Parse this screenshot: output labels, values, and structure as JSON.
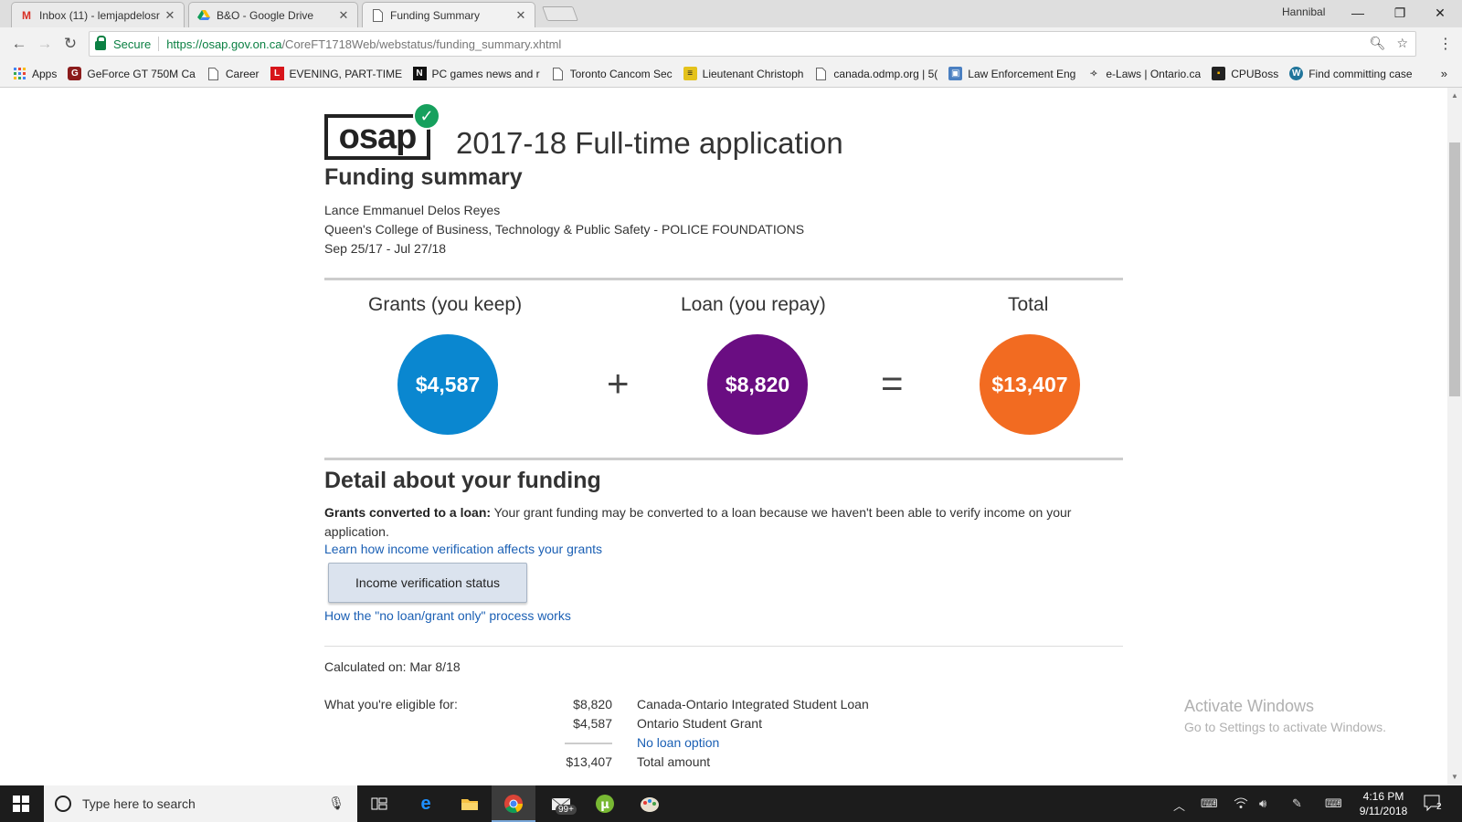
{
  "browser": {
    "tabs": [
      {
        "title": "Inbox (11) - lemjapdelosr",
        "icon": "gmail-icon"
      },
      {
        "title": "B&O - Google Drive",
        "icon": "google-drive-icon"
      },
      {
        "title": "Funding Summary",
        "icon": "page-icon"
      }
    ],
    "window_user": "Hannibal",
    "secure_label": "Secure",
    "url_host": "https://osap.gov.on.ca",
    "url_path": "/CoreFT1718Web/webstatus/funding_summary.xhtml",
    "bookmarks": [
      {
        "label": "Apps"
      },
      {
        "label": "GeForce GT 750M Ca"
      },
      {
        "label": "Career"
      },
      {
        "label": "EVENING, PART-TIME"
      },
      {
        "label": "PC games news and r"
      },
      {
        "label": "Toronto Cancom Sec"
      },
      {
        "label": "Lieutenant Christoph"
      },
      {
        "label": "canada.odmp.org | 5("
      },
      {
        "label": "Law Enforcement Eng"
      },
      {
        "label": "e-Laws | Ontario.ca"
      },
      {
        "label": "CPUBoss"
      },
      {
        "label": "Find committing case"
      }
    ]
  },
  "page": {
    "logo_text": "osap",
    "title": "2017-18 Full-time application",
    "subtitle": "Funding summary",
    "student_name": "Lance Emmanuel Delos Reyes",
    "program": "Queen's College of Business, Technology & Public Safety - POLICE FOUNDATIONS",
    "dates": "Sep 25/17 - Jul 27/18",
    "funding": {
      "grants_label": "Grants (you keep)",
      "grants_amount": "$4,587",
      "loan_label": "Loan (you repay)",
      "loan_amount": "$8,820",
      "total_label": "Total",
      "total_amount": "$13,407",
      "plus": "+",
      "equals": "=",
      "colors": {
        "grants": "#0a87d0",
        "loan": "#6a0d82",
        "total": "#f26b21"
      }
    },
    "detail": {
      "heading": "Detail about your funding",
      "bold_lead": "Grants converted to a loan:",
      "text": " Your grant funding may be converted to a loan because we haven't been able to verify income on your application.",
      "link_income": "Learn how income verification affects your grants",
      "button_income": "Income verification status",
      "link_process": "How the \"no loan/grant only\" process works"
    },
    "calculated": "Calculated on: Mar 8/18",
    "eligible_label": "What you're eligible for:",
    "eligible_rows": [
      {
        "amount": "$8,820",
        "desc": "Canada-Ontario Integrated Student Loan"
      },
      {
        "amount": "$4,587",
        "desc": "Ontario Student Grant"
      }
    ],
    "no_loan_option": "No loan option",
    "total_amount": "$13,407",
    "total_desc": "Total amount"
  },
  "watermark": {
    "line1": "Activate Windows",
    "line2": "Go to Settings to activate Windows."
  },
  "taskbar": {
    "search_placeholder": "Type here to search",
    "mail_badge": "99+",
    "time": "4:16 PM",
    "date": "9/11/2018",
    "notification_count": "2"
  }
}
